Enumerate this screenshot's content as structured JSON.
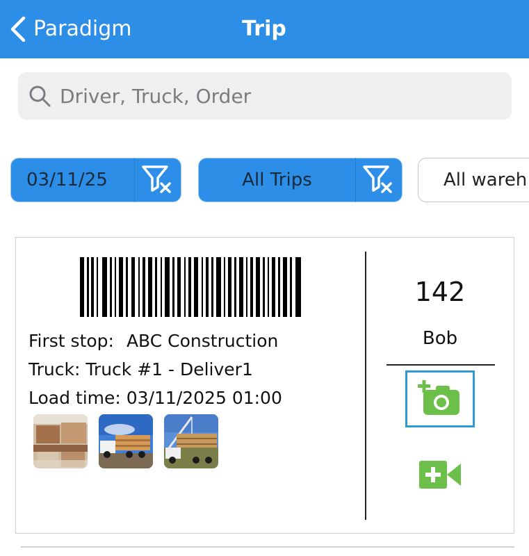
{
  "nav": {
    "back_label": "Paradigm",
    "title": "Trip"
  },
  "search": {
    "placeholder": "Driver, Truck, Order",
    "value": ""
  },
  "filters": [
    {
      "label": "03/11/25",
      "active": true
    },
    {
      "label": "All Trips",
      "active": true
    },
    {
      "label": "All wareh",
      "active": false
    }
  ],
  "trip": {
    "number": "142",
    "driver": "Bob",
    "first_stop_label": "First stop:",
    "first_stop_value": "ABC Construction",
    "truck_label": "Truck:",
    "truck_value": "Truck #1 - Deliver1",
    "load_time_label": "Load time:",
    "load_time_value": "03/11/2025 01:00",
    "photos": [
      "photo-lumber-stack",
      "photo-truck-lumber",
      "photo-crane-truck"
    ]
  },
  "icons": {
    "back": "chevron-left-icon",
    "search": "search-icon",
    "filter_clear": "filter-clear-icon",
    "add_photo": "add-photo-camera-icon",
    "add_video": "add-video-camera-icon"
  },
  "colors": {
    "nav_bar": "#2c8ee6",
    "active_chip": "#2c8ee6",
    "media_green": "#6cc04a",
    "selection_outline": "#2d9ad6"
  }
}
